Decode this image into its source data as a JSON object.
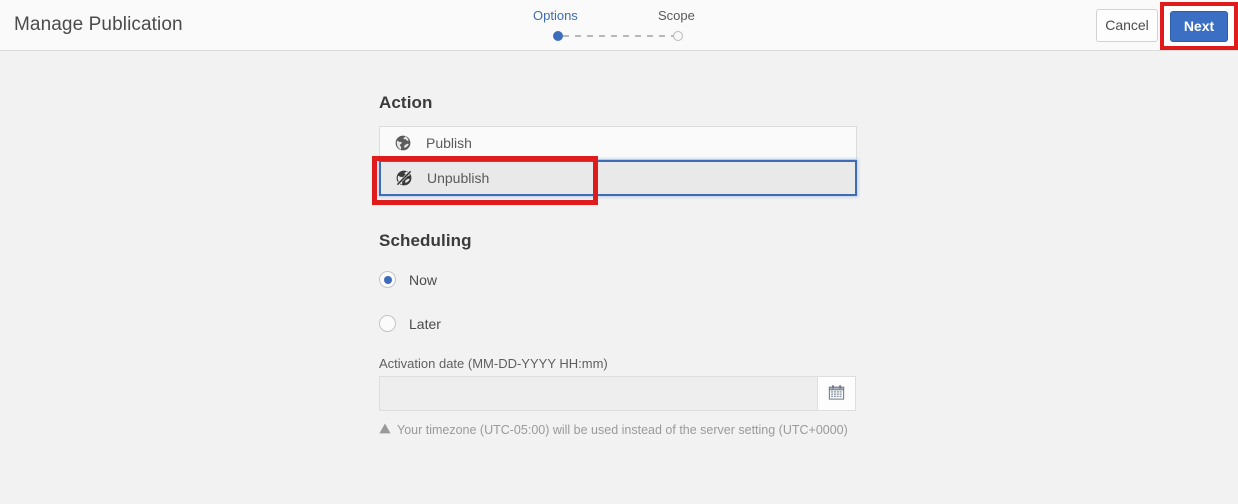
{
  "header": {
    "title": "Manage Publication",
    "cancel_label": "Cancel",
    "next_label": "Next",
    "accent_color": "#3a6fc4",
    "highlight_color": "#e01b1b"
  },
  "stepper": {
    "steps": [
      {
        "label": "Options",
        "state": "active"
      },
      {
        "label": "Scope",
        "state": "inactive"
      }
    ]
  },
  "action": {
    "heading": "Action",
    "options": [
      {
        "label": "Publish",
        "icon": "globe-icon",
        "selected": false
      },
      {
        "label": "Unpublish",
        "icon": "globe-slash-icon",
        "selected": true
      }
    ]
  },
  "scheduling": {
    "heading": "Scheduling",
    "options": [
      {
        "label": "Now",
        "checked": true
      },
      {
        "label": "Later",
        "checked": false
      }
    ],
    "date_field": {
      "label": "Activation date (MM-DD-YYYY HH:mm)",
      "value": "",
      "placeholder": "",
      "calendar_icon": "calendar-icon"
    },
    "timezone_note": {
      "icon": "warning-icon",
      "text": "Your timezone (UTC-05:00) will be used instead of the server setting (UTC+0000)"
    }
  }
}
